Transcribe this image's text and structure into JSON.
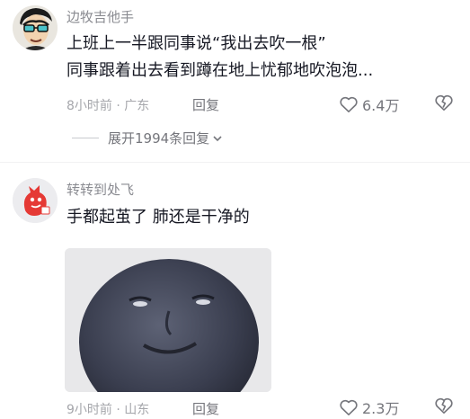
{
  "comments": [
    {
      "username": "边牧吉他手",
      "lines": [
        "上班上一半跟同事说“我出去吹一根”",
        "同事跟着出去看到蹲在地上忧郁地吹泡泡..."
      ],
      "time": "8小时前",
      "location": "广东",
      "reply_label": "回复",
      "likes": "6.4万",
      "avatar_icon": "comic-face-avatar",
      "expand_label": "展开1994条回复"
    },
    {
      "username": "转转到处飞",
      "lines": [
        "手都起茧了 肺还是干净的"
      ],
      "time": "9小时前",
      "location": "山东",
      "reply_label": "回复",
      "likes": "2.3万",
      "avatar_icon": "red-cartoon-avatar",
      "sticker_icon": "dark-round-face-sticker"
    }
  ],
  "colors": {
    "text": "#161823",
    "username": "#8a8b91",
    "meta": "#a5a6ab",
    "action": "#75767c",
    "avatar_red": "#e53935"
  }
}
